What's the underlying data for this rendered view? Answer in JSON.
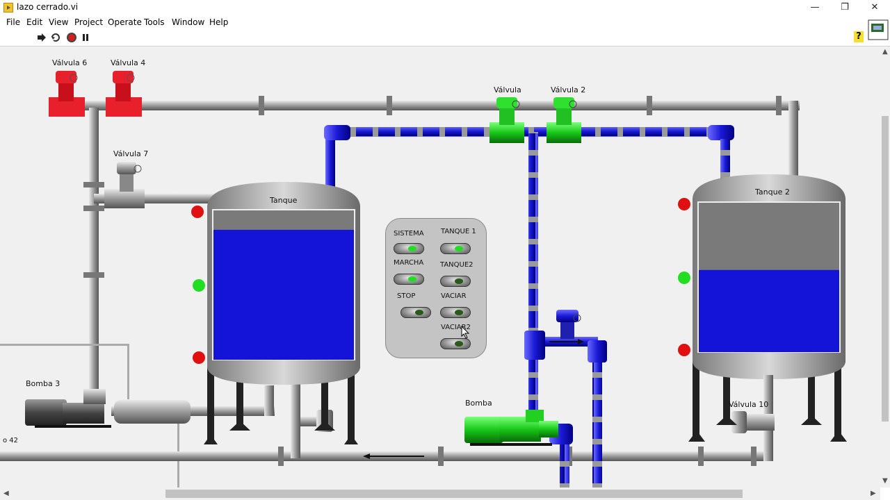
{
  "window": {
    "title": "lazo cerrado.vi",
    "minimize": "—",
    "maximize": "❐",
    "close": "✕"
  },
  "menu": [
    "File",
    "Edit",
    "View",
    "Project",
    "Operate",
    "Tools",
    "Window",
    "Help"
  ],
  "toolbar": {
    "run": "run-arrow-icon",
    "continuous": "run-continuously-icon",
    "abort": "abort-icon",
    "pause": "pause-icon",
    "help": "?"
  },
  "labels": {
    "valve6": "Válvula 6",
    "valve4": "Válvula 4",
    "valve7": "Válvula 7",
    "valve": "Válvula",
    "valve2": "Válvula 2",
    "valve10": "Válvula 10",
    "tank1": "Tanque",
    "tank2": "Tanque 2",
    "pump3": "Bomba 3",
    "pump": "Bomba",
    "edge_text": "o 42"
  },
  "levels": {
    "tank1": 0.87,
    "tank2": 0.55
  },
  "panel": {
    "sistema": "SISTEMA",
    "marcha": "MARCHA",
    "stop": "STOP",
    "tanque1": "TANQUE 1",
    "tanque2": "TANQUE2",
    "vaciar": "VACIAR",
    "vaciar2": "VACIAR2"
  },
  "colors": {
    "water": "#1414d8",
    "pipe_blue": "#1a1ad6",
    "valve_open": "#22e028",
    "valve_closed": "#e8202c",
    "led_on": "#22dd22",
    "led_off": "#e01010",
    "led_dark": "#2a5a1a"
  }
}
